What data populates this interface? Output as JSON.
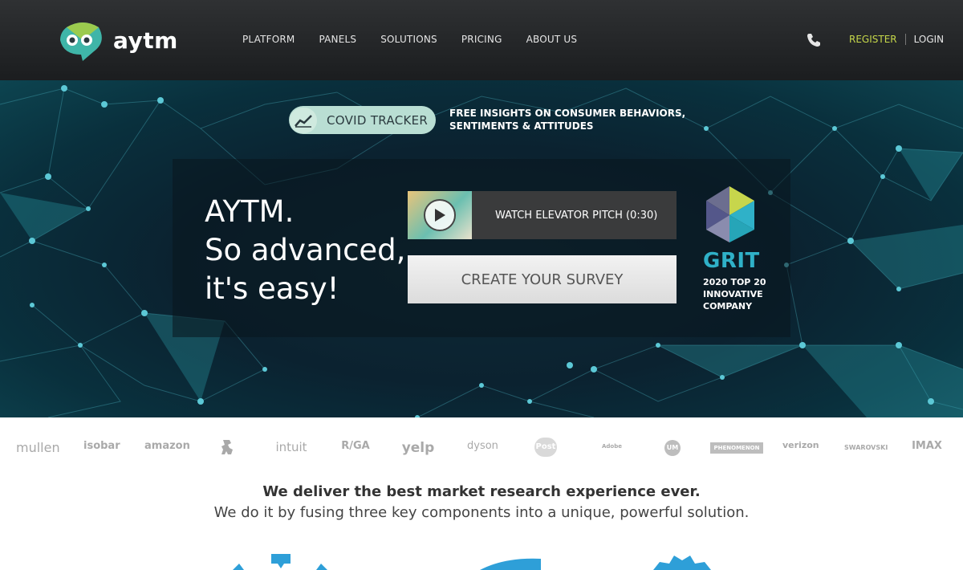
{
  "header": {
    "logo_text": "aytm",
    "nav": [
      "PLATFORM",
      "PANELS",
      "SOLUTIONS",
      "PRICING",
      "ABOUT US"
    ],
    "register_label": "REGISTER",
    "login_label": "LOGIN",
    "phone_icon": "phone-icon"
  },
  "hero": {
    "covid_label": "COVID TRACKER",
    "covid_desc_line1": "FREE INSIGHTS ON CONSUMER BEHAVIORS,",
    "covid_desc_line2": "SENTIMENTS & ATTITUDES",
    "headline_line1": "AYTM.",
    "headline_line2": "So advanced,",
    "headline_line3": "it's easy!",
    "pitch_label": "WATCH ELEVATOR PITCH (0:30)",
    "create_label": "CREATE YOUR SURVEY",
    "grit_title": "GRIT",
    "grit_line1": "2020 TOP 20",
    "grit_line2": "INNOVATIVE",
    "grit_line3": "COMPANY"
  },
  "clients": [
    "mullen",
    "isobar",
    "amazon",
    "",
    "intuit",
    "R/GA",
    "yelp",
    "dyson",
    "Post",
    "Adobe",
    "UM",
    "PHENOMENON",
    "verizon",
    "SWAROVSKI",
    "IMAX"
  ],
  "deliver": {
    "heading": "We deliver the best market research experience ever.",
    "subheading": "We do it by fusing three key components into a unique, powerful solution."
  },
  "colors": {
    "accent_green": "#c6d84a",
    "accent_teal": "#2fb1c8",
    "header_bg": "#1f2123",
    "shape_blue": "#2e9fd8"
  }
}
